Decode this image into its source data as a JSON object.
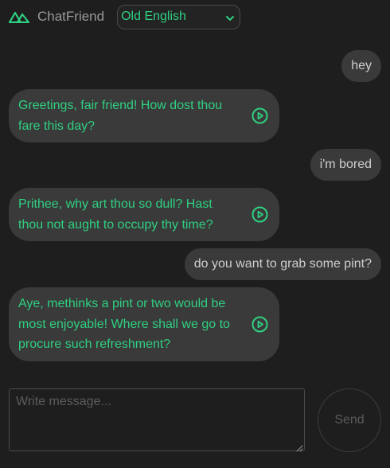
{
  "header": {
    "brand": "ChatFriend",
    "language_selected": "Old English",
    "logo_icon": "mountain-logo-icon"
  },
  "colors": {
    "background": "#1e1e1e",
    "bubble": "#3a3a3a",
    "accent": "#2fd081",
    "user_text": "#cfcfcf"
  },
  "messages": [
    {
      "role": "user",
      "text": "hey"
    },
    {
      "role": "bot",
      "text": "Greetings, fair friend! How dost thou fare this day?",
      "icon": "play-circle-icon"
    },
    {
      "role": "user",
      "text": "i'm bored"
    },
    {
      "role": "bot",
      "text": "Prithee, why art thou so dull? Hast thou not aught to occupy thy time?",
      "icon": "play-circle-icon"
    },
    {
      "role": "user",
      "text": "do you want to grab some pint?"
    },
    {
      "role": "bot",
      "text": "Aye, methinks a pint or two would be most enjoyable! Where shall we go to procure such refreshment?",
      "icon": "play-circle-icon"
    }
  ],
  "composer": {
    "placeholder": "Write message...",
    "value": "",
    "send_label": "Send"
  }
}
